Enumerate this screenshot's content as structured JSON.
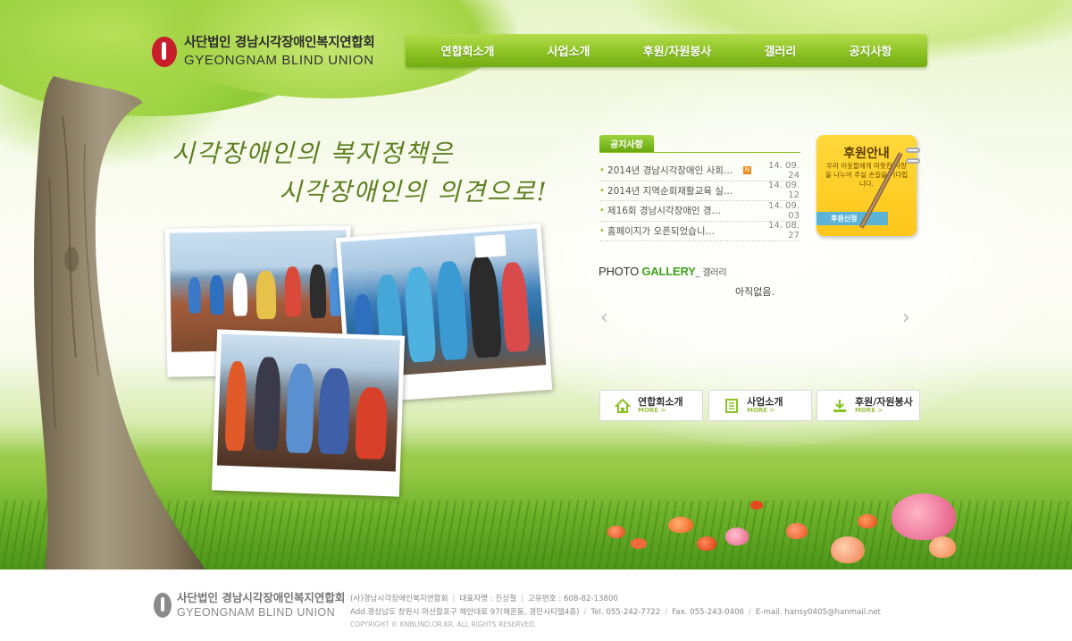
{
  "site": {
    "logo_kr": "사단법인 경남시각장애인복지연합회",
    "logo_en": "GYEONGNAM BLIND UNION"
  },
  "nav": {
    "items": [
      {
        "label": "연합회소개"
      },
      {
        "label": "사업소개"
      },
      {
        "label": "후원/자원봉사"
      },
      {
        "label": "갤러리"
      },
      {
        "label": "공지사항"
      }
    ]
  },
  "slogan": {
    "line1": "시각장애인의 복지정책은",
    "line2": "시각장애인의 의견으로!"
  },
  "notice": {
    "tab_label": "공지사항",
    "items": [
      {
        "title": "2014년 경남시각장애인 사회…",
        "new_badge": "N",
        "date": "14. 09. 24"
      },
      {
        "title": "2014년 지역순회재활교육 실…",
        "date": "14. 09. 12"
      },
      {
        "title": "제16회 경남시각장애인 경…",
        "date": "14. 09. 03"
      },
      {
        "title": "홈페이지가 오픈되었습니…",
        "date": "14. 08. 27"
      }
    ]
  },
  "support": {
    "title": "후원안내",
    "desc": "우리 이웃들에게 따뜻한 사랑을 나누어 주실 손길을 기다립니다.",
    "button": "후원신청"
  },
  "gallery": {
    "title_photo": "PHOTO ",
    "title_gallery": "GALLERY",
    "title_kr": "_ 갤러리",
    "empty_text": "아직없음.",
    "prev_icon": "chevron-left-icon",
    "next_icon": "chevron-right-icon"
  },
  "quick_links": [
    {
      "label": "연합회소개",
      "more": "MORE >",
      "icon": "home-icon"
    },
    {
      "label": "사업소개",
      "more": "MORE >",
      "icon": "document-list-icon"
    },
    {
      "label": "후원/자원봉사",
      "more": "MORE >",
      "icon": "download-icon"
    }
  ],
  "footer": {
    "logo_kr": "사단법인 경남시각장애인복지연합회",
    "logo_en": "GYEONGNAM BLIND UNION",
    "org_name": "(사)경남시각장애인복지연합회",
    "rep": "대표자명 : 진상철",
    "reg_no": "고유번호 : 608-82-13800",
    "address": "Add.경상남도 창원시 마산합포구 해안대로 97(해운동, 경민시티텔4층)",
    "tel": "Tel. 055-242-7722",
    "fax": "Fax. 055-243-0406",
    "email": "E-mail. hansy0405@hanmail.net",
    "copyright": "COPYRIGHT © KNBLIND.OR.KR. ALL RIGHTS RESERVED."
  },
  "colors": {
    "nav_green": "#8cc324",
    "accent_green": "#3fa21c",
    "support_yellow": "#ffc61a",
    "logo_red": "#c81d2a"
  }
}
